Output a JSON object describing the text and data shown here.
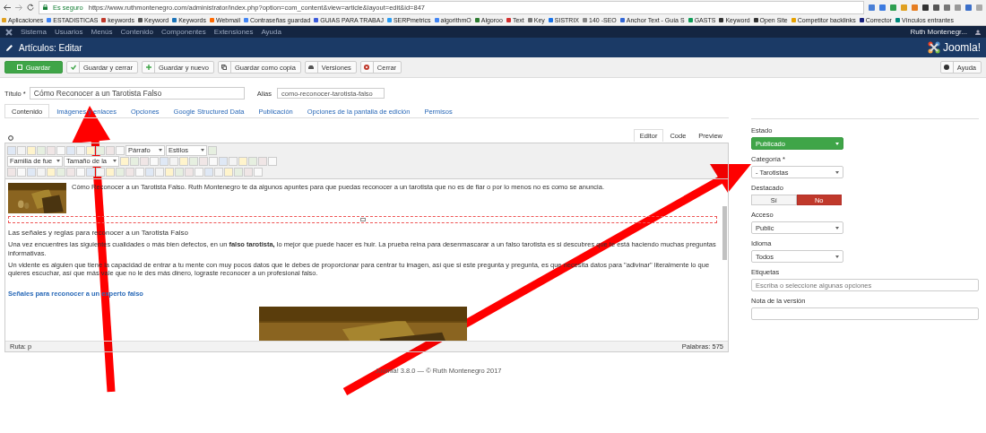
{
  "browser": {
    "secure_label": "Es seguro",
    "url": "https://www.ruthmontenegro.com/administrator/index.php?option=com_content&view=article&layout=edit&id=847"
  },
  "bookmarks": [
    {
      "label": "Aplicaciones",
      "color": "#e0a020"
    },
    {
      "label": "ESTADISTICAS",
      "color": "#4285f4"
    },
    {
      "label": "keywords",
      "color": "#c0392b"
    },
    {
      "label": "Keyword",
      "color": "#555555"
    },
    {
      "label": "Keywords",
      "color": "#1a73b8"
    },
    {
      "label": "Webmail",
      "color": "#ff6a00"
    },
    {
      "label": "Contraseñas guardad",
      "color": "#4285f4"
    },
    {
      "label": "GUIAS PARA TRABAJ",
      "color": "#3b5bdb"
    },
    {
      "label": "SERPmetrics",
      "color": "#2a9df4"
    },
    {
      "label": "algorithmO",
      "color": "#4285f4"
    },
    {
      "label": "Algoroo",
      "color": "#2e7d32"
    },
    {
      "label": "Text",
      "color": "#d32f2f"
    },
    {
      "label": "Key",
      "color": "#777777"
    },
    {
      "label": "SISTRIX",
      "color": "#1a73e8"
    },
    {
      "label": "140 -SEO",
      "color": "#888888"
    },
    {
      "label": "Anchor Text - Guía S",
      "color": "#3367d6"
    },
    {
      "label": "GASTS",
      "color": "#0f9d58"
    },
    {
      "label": "Keyword",
      "color": "#333333"
    },
    {
      "label": "Open Site",
      "color": "#333333"
    },
    {
      "label": "Competitor backlinks",
      "color": "#e6a100"
    },
    {
      "label": "Corrector",
      "color": "#1a237e"
    },
    {
      "label": "Vínculos entrantes",
      "color": "#00897b"
    }
  ],
  "menu": {
    "items": [
      "Sistema",
      "Usuarios",
      "Menús",
      "Contenido",
      "Componentes",
      "Extensiones",
      "Ayuda"
    ],
    "user": "Ruth Montenegr..."
  },
  "header": {
    "title": "Artículos: Editar",
    "logo": "Joomla!"
  },
  "toolbar": [
    {
      "label": "Guardar",
      "kind": "save"
    },
    {
      "label": "Guardar y cerrar",
      "kind": "check"
    },
    {
      "label": "Guardar y nuevo",
      "kind": "plus"
    },
    {
      "label": "Guardar como copia",
      "kind": "copy"
    },
    {
      "label": "Versiones",
      "kind": "versions"
    },
    {
      "label": "Cerrar",
      "kind": "close"
    }
  ],
  "help_button": "Ayuda",
  "title_field": {
    "label": "Título *",
    "value": "Cómo Reconocer a un Tarotista Falso"
  },
  "alias_field": {
    "label": "Alias",
    "value": "como-reconocer-tarotista-falso"
  },
  "tabs": [
    {
      "label": "Contenido",
      "selected": true
    },
    {
      "label": "Imágenes y enlaces",
      "selected": false
    },
    {
      "label": "Opciones",
      "selected": false
    },
    {
      "label": "Google Structured Data",
      "selected": false
    },
    {
      "label": "Publicación",
      "selected": false
    },
    {
      "label": "Opciones de la pantalla de edición",
      "selected": false
    },
    {
      "label": "Permisos",
      "selected": false
    }
  ],
  "editor_tabs": [
    {
      "label": "Editor",
      "selected": true
    },
    {
      "label": "Code",
      "selected": false
    },
    {
      "label": "Preview",
      "selected": false
    }
  ],
  "editor_selects": {
    "format": "Párrafo",
    "styles": "Estilos",
    "font_family": "Familia de fue",
    "font_size": "Tamaño de la"
  },
  "content": {
    "intro": "Cómo Reconocer a un Tarotista Falso. Ruth Montenegro te da algunos apuntes para que puedas reconocer a un tarotista que no es de fiar o por lo menos no es como se anuncia.",
    "heading": "Las señales y reglas para reconocer a un Tarotista Falso",
    "paragraphs": [
      "Una vez encuentres las siguientes cualidades o más bien defectos, en un **falso tarotista,** lo mejor que puede hacer es huir. La prueba reina para desenmascarar a un falso tarotista es si descubres que te está haciendo muchas preguntas informativas.",
      "Un vidente es alguien que tiene la capacidad de entrar a tu mente con muy pocos datos que le debes de proporcionar para centrar tu imagen, así que si este pregunta y pregunta, es que necesita datos para \"adivinar\" literalmente lo que quieres escuchar, así que más vale que no le des más dinero, lograste reconocer a un profesional falso."
    ],
    "link": "Señales para reconocer a un experto falso"
  },
  "status": {
    "path": "Ruta: p",
    "words": "Palabras: 575"
  },
  "footer": "Joomla! 3.8.0  —  © Ruth Montenegro 2017",
  "sidebar": [
    {
      "kind": "select",
      "label": "Estado",
      "value": "Publicado",
      "highlighted": true
    },
    {
      "kind": "select",
      "label": "Categoría *",
      "value": "- Tarotistas",
      "highlighted": false
    },
    {
      "kind": "toggle",
      "label": "Destacado",
      "options": [
        {
          "label": "Sí",
          "selected": false
        },
        {
          "label": "No",
          "selected": true
        }
      ]
    },
    {
      "kind": "select",
      "label": "Acceso",
      "value": "Public",
      "highlighted": false
    },
    {
      "kind": "select",
      "label": "Idioma",
      "value": "Todos",
      "highlighted": false
    },
    {
      "kind": "input",
      "label": "Etiquetas",
      "placeholder": "Escriba o seleccione algunas opciones"
    },
    {
      "kind": "input",
      "label": "Nota de la versión"
    }
  ]
}
